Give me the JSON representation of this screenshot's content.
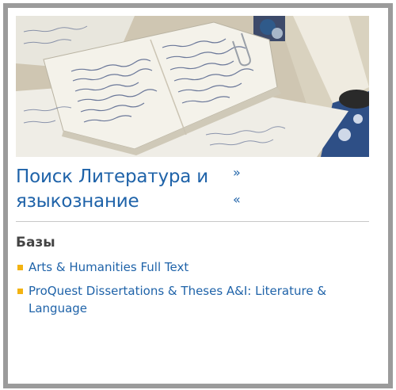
{
  "header": {
    "image_alt": "",
    "title": "Поиск Литература и языкознание",
    "expand_glyph": "»",
    "collapse_glyph": "«"
  },
  "sections": {
    "databases_heading": "Базы"
  },
  "databases": [
    {
      "label": "Arts & Humanities Full Text"
    },
    {
      "label": "ProQuest Dissertations & Theses A&I: Literature & Language"
    }
  ],
  "colors": {
    "link": "#1f63a9",
    "bullet": "#f3b312",
    "frame": "#9b9b9b"
  }
}
